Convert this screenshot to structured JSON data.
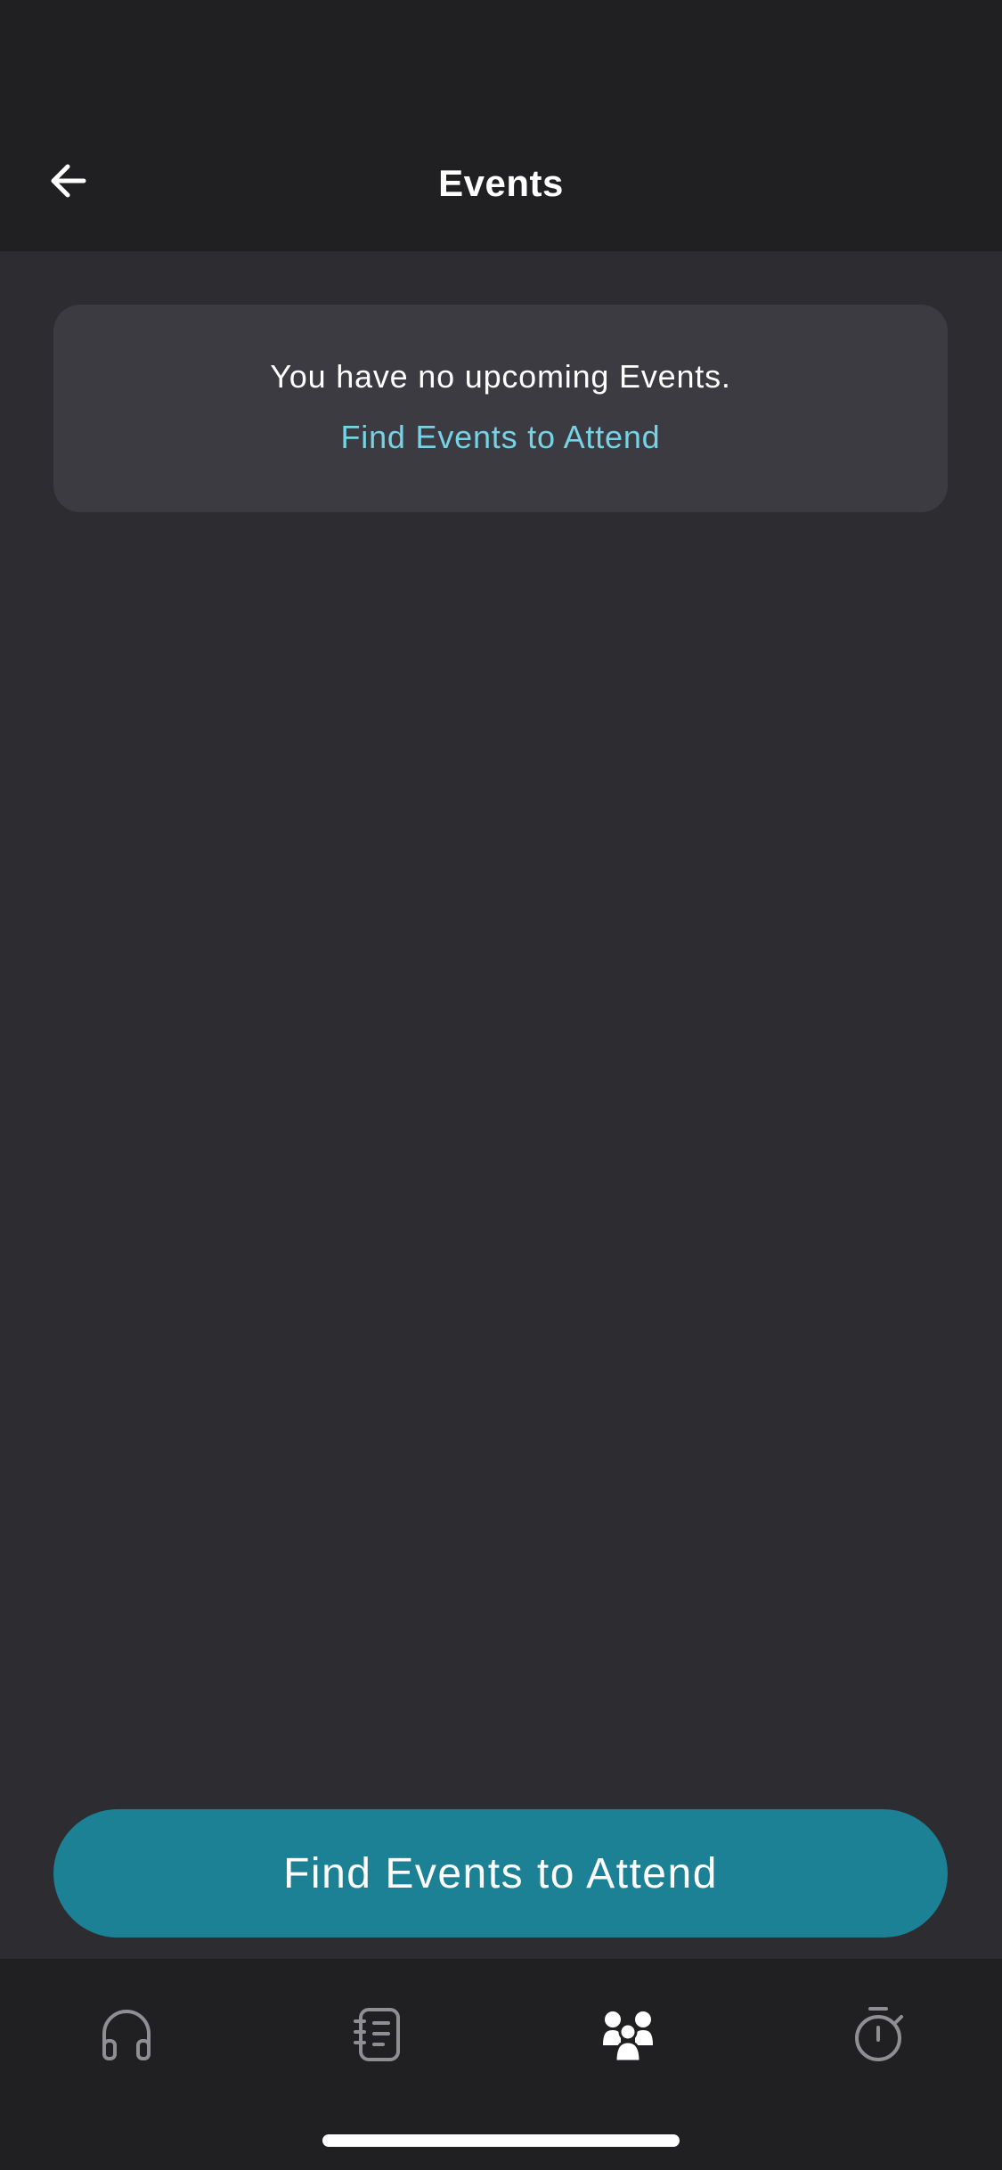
{
  "header": {
    "title": "Events",
    "back_icon": "arrow-left-icon"
  },
  "empty_state": {
    "message": "You have no upcoming Events.",
    "link_label": "Find Events to Attend"
  },
  "primary_action": {
    "label": "Find Events to Attend"
  },
  "tab_bar": {
    "tabs": [
      {
        "icon": "headphones-icon",
        "active": false
      },
      {
        "icon": "journal-icon",
        "active": false
      },
      {
        "icon": "community-icon",
        "active": true
      },
      {
        "icon": "timer-icon",
        "active": false
      }
    ]
  },
  "colors": {
    "background": "#2c2c31",
    "header_background": "#202023",
    "card_background": "#3b3b41",
    "link": "#76d3e5",
    "button": "#1c8194",
    "inactive_icon": "#8e8e93",
    "active_icon": "#ffffff"
  }
}
